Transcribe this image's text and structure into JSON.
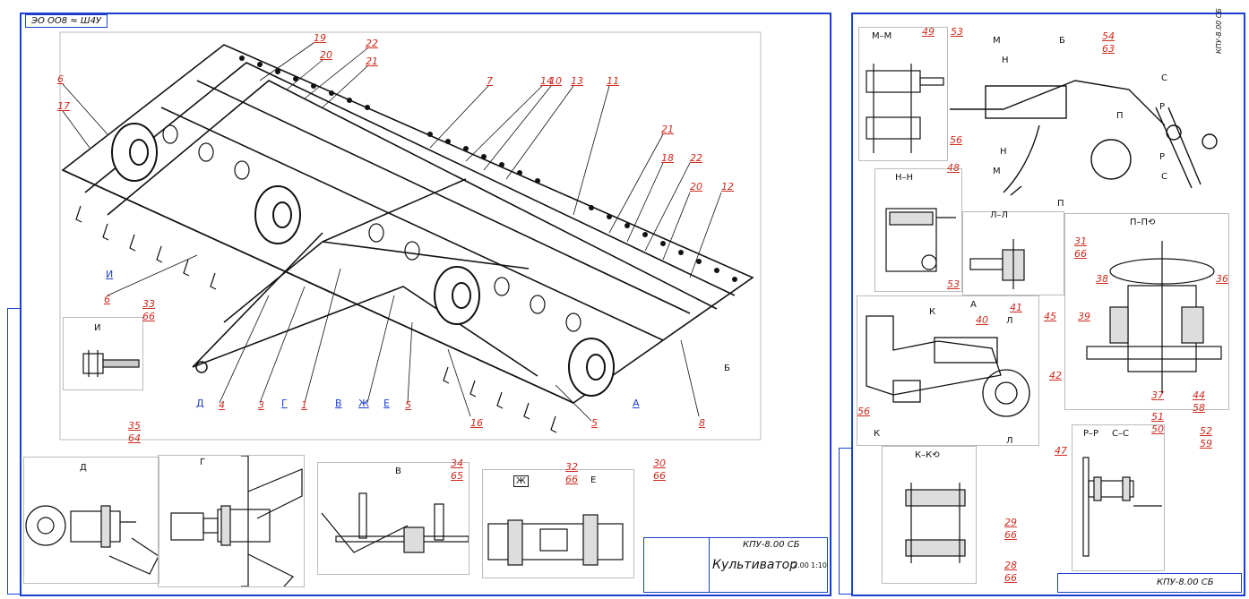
{
  "left_sheet": {
    "stamp_code": "ЭО ОО8 ≈ Ш4У",
    "title_code": "КПУ-8.00 СБ",
    "title": "Культиватор",
    "tb_numbers": [
      "2.00",
      "1:10"
    ],
    "callouts": [
      "6",
      "17",
      "19",
      "20",
      "22",
      "21",
      "7",
      "14",
      "10",
      "13",
      "11",
      "21",
      "18",
      "22",
      "20",
      "12",
      "6",
      "8",
      "5",
      "16",
      "5",
      "4",
      "3",
      "1",
      "Д",
      "Г",
      "В",
      "Ж",
      "Е",
      "И",
      "Б",
      "А"
    ],
    "views": {
      "I": {
        "label": "И",
        "refs": [
          "33",
          "66"
        ]
      },
      "D": {
        "label": "Д",
        "refs": [
          "35",
          "64"
        ]
      },
      "G": {
        "label": "Г"
      },
      "V": {
        "label": "В",
        "refs": [
          "34",
          "65"
        ]
      },
      "ZH": {
        "label": "Ж",
        "refs": [
          "32",
          "66"
        ]
      },
      "E": {
        "label": "Е",
        "refs": [
          "30",
          "66"
        ]
      }
    }
  },
  "right_sheet": {
    "vertical_code": "КПУ-8.00 СБ",
    "title_code": "КПУ-8.00 СБ",
    "views": {
      "MM": {
        "label": "М–М",
        "refs": [
          "49",
          "53"
        ]
      },
      "B": {
        "label": "Б",
        "refs": [
          "54",
          "63",
          "56"
        ],
        "markers": [
          "М",
          "Н",
          "Н",
          "М",
          "С",
          "Р",
          "П",
          "Р",
          "С",
          "П"
        ]
      },
      "NN": {
        "label": "Н–Н",
        "refs": [
          "48",
          "53"
        ]
      },
      "LL": {
        "label": "Л–Л",
        "refs": [
          "31",
          "66"
        ]
      },
      "PP": {
        "label": "П–П⟲",
        "refs": [
          "38",
          "36",
          "45",
          "39",
          "37",
          "44",
          "51",
          "58",
          "50"
        ]
      },
      "A": {
        "label": "А",
        "refs": [
          "41",
          "40",
          "42",
          "56"
        ],
        "markers": [
          "К",
          "Л",
          "К",
          "Л"
        ]
      },
      "KK": {
        "label": "К–К⟲",
        "refs": [
          "29",
          "66",
          "28",
          "66"
        ]
      },
      "RR": {
        "label": "Р–Р",
        "refs": [
          "47"
        ]
      },
      "SS": {
        "label": "С–С",
        "refs": [
          "52",
          "59"
        ]
      }
    }
  }
}
